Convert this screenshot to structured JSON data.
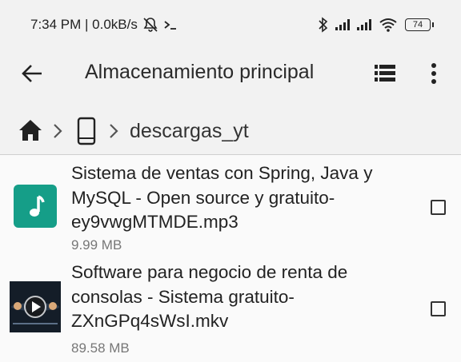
{
  "status_bar": {
    "time_speed": "7:34 PM | 0.0kB/s",
    "battery": "74",
    "icons": [
      "mute-bell-icon",
      "terminal-icon",
      "bluetooth-icon",
      "signal-icon",
      "signal-icon",
      "wifi-icon",
      "battery-icon"
    ]
  },
  "app_bar": {
    "title": "Almacenamiento principal",
    "icons": [
      "back-arrow-icon",
      "list-view-icon",
      "more-vert-icon"
    ]
  },
  "breadcrumb": {
    "icons": [
      "home-icon",
      "chevron-right-icon",
      "phone-icon",
      "chevron-right-icon"
    ],
    "current": "descargas_yt"
  },
  "files": [
    {
      "name": "Sistema de ventas con Spring, Java y MySQL - Open source y gratuito-ey9vwgMTMDE.mp3",
      "size": "9.99 MB",
      "icon": "music-note-icon",
      "checked": false,
      "color": "#159e88"
    },
    {
      "name": "Software para negocio de renta de consolas - Sistema gratuito-ZXnGPq4sWsI.mkv",
      "size": "89.58 MB",
      "icon": "video-thumbnail",
      "checked": false
    }
  ]
}
